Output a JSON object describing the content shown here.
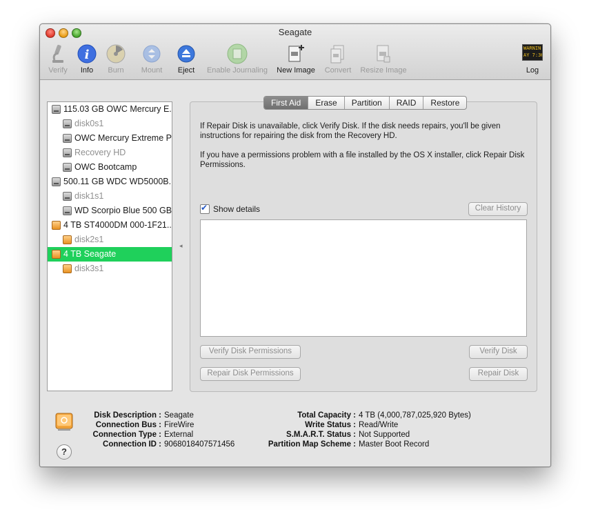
{
  "window": {
    "title": "Seagate"
  },
  "toolbar": {
    "verify": "Verify",
    "info": "Info",
    "burn": "Burn",
    "mount": "Mount",
    "eject": "Eject",
    "enable_journaling": "Enable Journaling",
    "new_image": "New Image",
    "convert": "Convert",
    "resize_image": "Resize Image",
    "log": "Log",
    "log_icon_text_1": "WARNIN",
    "log_icon_text_2": "AY 7:36"
  },
  "sidebar": {
    "items": [
      {
        "label": "115.03 GB OWC Mercury E...",
        "icon": "hdd-icon",
        "level": 0,
        "dim": false
      },
      {
        "label": "disk0s1",
        "icon": "hdd-icon",
        "level": 1,
        "dim": true
      },
      {
        "label": "OWC Mercury Extreme Pro",
        "icon": "hdd-icon",
        "level": 1,
        "dim": false
      },
      {
        "label": "Recovery HD",
        "icon": "hdd-icon",
        "level": 1,
        "dim": true
      },
      {
        "label": "OWC Bootcamp",
        "icon": "hdd-icon",
        "level": 1,
        "dim": false
      },
      {
        "label": "500.11 GB WDC WD5000B...",
        "icon": "hdd-icon",
        "level": 0,
        "dim": false
      },
      {
        "label": "disk1s1",
        "icon": "hdd-icon",
        "level": 1,
        "dim": true
      },
      {
        "label": "WD Scorpio Blue 500 GB",
        "icon": "hdd-icon",
        "level": 1,
        "dim": false
      },
      {
        "label": "4 TB ST4000DM 000-1F21...",
        "icon": "external-drive-icon",
        "level": 0,
        "dim": false
      },
      {
        "label": "disk2s1",
        "icon": "external-drive-icon",
        "level": 1,
        "dim": true
      },
      {
        "label": "4 TB Seagate",
        "icon": "external-drive-icon",
        "level": 0,
        "dim": false,
        "selected": true
      },
      {
        "label": "disk3s1",
        "icon": "external-drive-icon",
        "level": 1,
        "dim": true
      }
    ]
  },
  "tabs": [
    "First Aid",
    "Erase",
    "Partition",
    "RAID",
    "Restore"
  ],
  "first_aid": {
    "para1": "If Repair Disk is unavailable, click Verify Disk. If the disk needs repairs, you'll be given instructions for repairing the disk from the Recovery HD.",
    "para2": "If you have a permissions problem with a file installed by the OS X installer, click Repair Disk Permissions.",
    "show_details": "Show details",
    "show_details_checked": true,
    "clear_history": "Clear History",
    "verify_permissions": "Verify Disk Permissions",
    "repair_permissions": "Repair Disk Permissions",
    "verify_disk": "Verify Disk",
    "repair_disk": "Repair Disk"
  },
  "info": {
    "left": [
      {
        "label": "Disk Description :",
        "value": "Seagate"
      },
      {
        "label": "Connection Bus :",
        "value": "FireWire"
      },
      {
        "label": "Connection Type :",
        "value": "External"
      },
      {
        "label": "Connection ID :",
        "value": "9068018407571456"
      }
    ],
    "right": [
      {
        "label": "Total Capacity :",
        "value": "4 TB (4,000,787,025,920 Bytes)"
      },
      {
        "label": "Write Status :",
        "value": "Read/Write"
      },
      {
        "label": "S.M.A.R.T. Status :",
        "value": "Not Supported"
      },
      {
        "label": "Partition Map Scheme :",
        "value": "Master Boot Record"
      }
    ],
    "help": "?"
  },
  "colors": {
    "selection": "#1fd05b",
    "accent": "#2f6fd6"
  }
}
